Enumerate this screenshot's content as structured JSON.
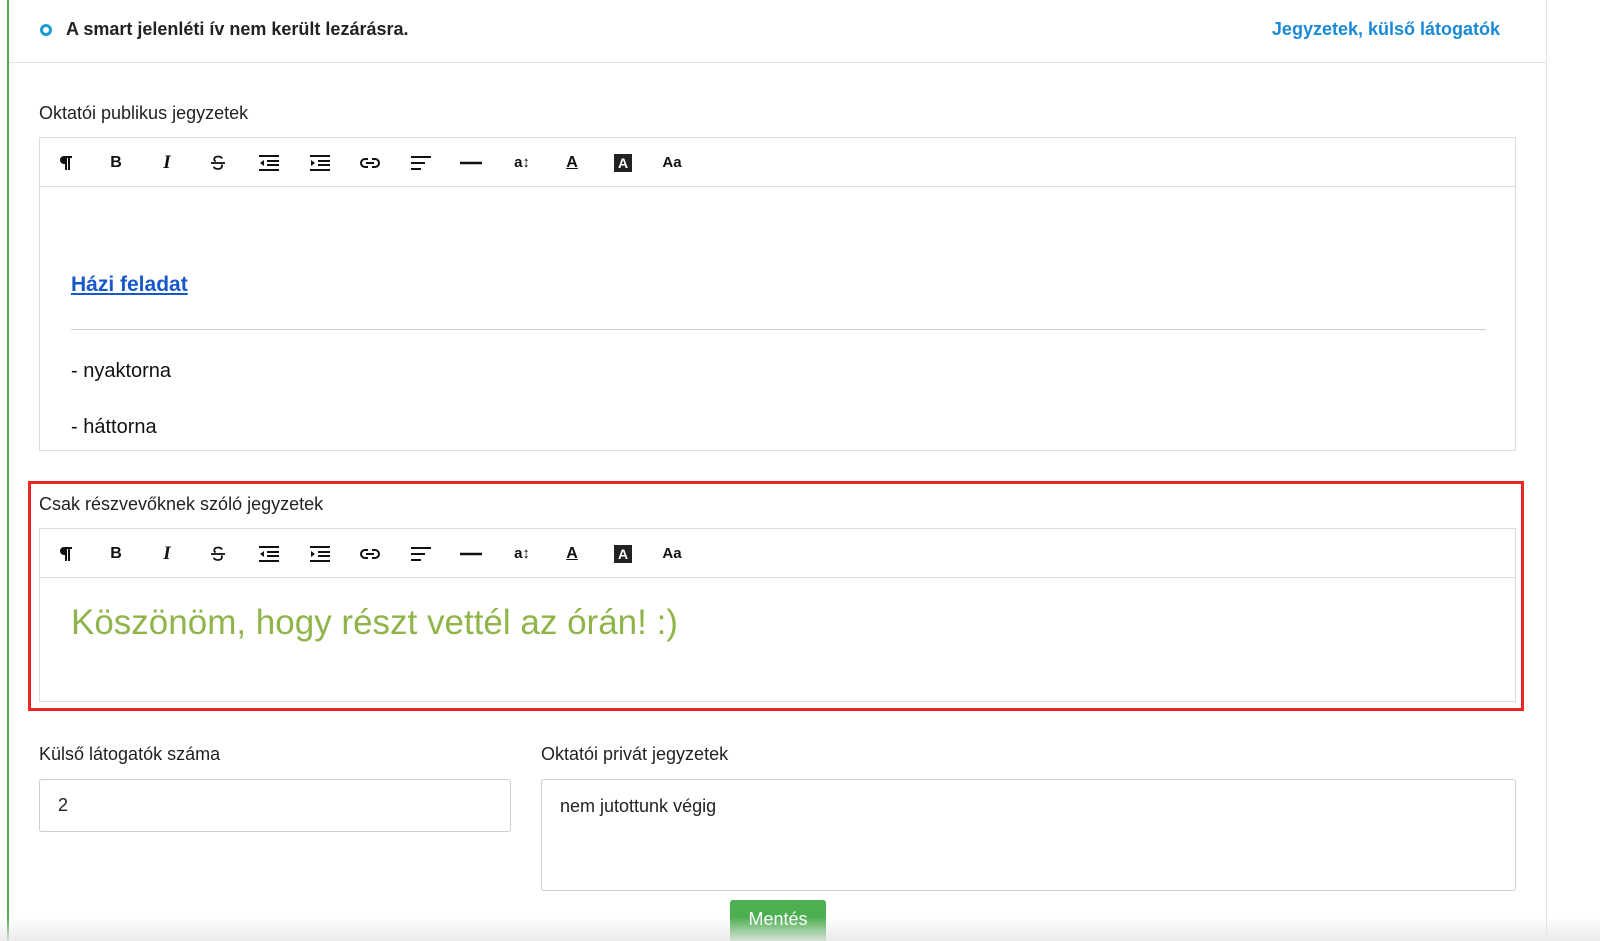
{
  "status": {
    "text": "A smart jelenléti ív nem került lezárásra.",
    "link": "Jegyzetek, külső látogatók",
    "dot_color": "#1a9bd7"
  },
  "public_notes": {
    "label": "Oktatói publikus jegyzetek",
    "link_text": "Házi feladat",
    "items": [
      "- nyaktorna",
      "- háttorna"
    ]
  },
  "participant_notes": {
    "label": "Csak részvevőknek szóló jegyzetek",
    "text": "Köszönöm, hogy részt vettél az órán! :)",
    "text_color": "#8fb54a"
  },
  "toolbar": {
    "bold": "B",
    "italic": "I",
    "font_size": "a↕",
    "font_case": "Aa",
    "text_color": "A",
    "highlight": "A"
  },
  "visitors": {
    "label": "Külső látogatók száma",
    "value": "2"
  },
  "private_notes": {
    "label": "Oktatói privát jegyzetek",
    "value": "nem jutottunk végig"
  },
  "save_button": "Mentés",
  "colors": {
    "accent_green": "#4caf50",
    "link_blue": "#1a8ad8",
    "highlight_red": "#e8251f"
  }
}
